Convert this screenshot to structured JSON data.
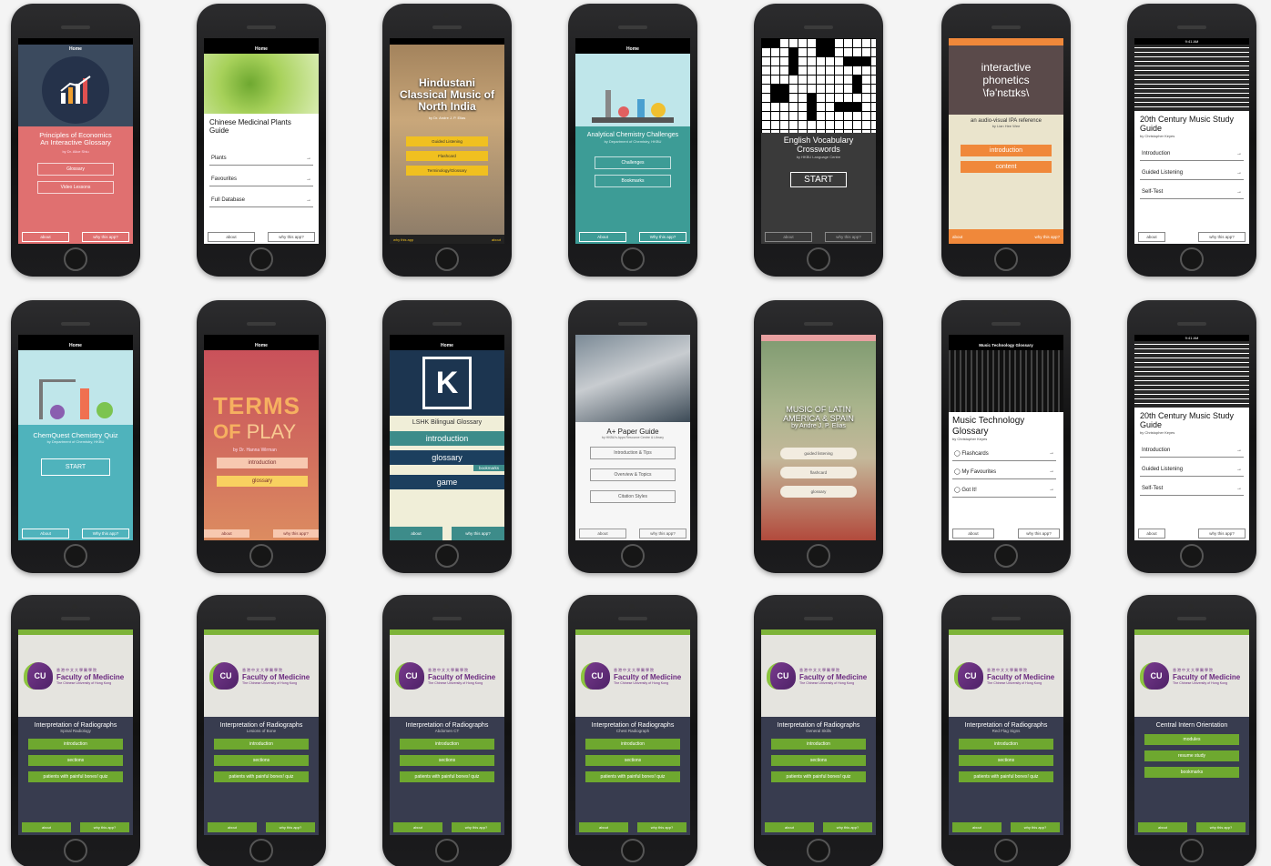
{
  "page": {
    "background": "#f4f4f4"
  },
  "phones": [
    {
      "id": "economics",
      "navbar": "Home",
      "title": "Principles of Economics",
      "subtitle": "An Interactive Glossary",
      "author": "by Dr. Alice Shiu",
      "buttons": [
        "Glossary",
        "Video Lessons"
      ],
      "footer": [
        "about",
        "why this app?"
      ],
      "icon": "bar-chart-icon",
      "color": "#e07070"
    },
    {
      "id": "plants",
      "navbar": "Home",
      "title": "Chinese Medicinal Plants Guide",
      "items": [
        "Plants",
        "Favourites",
        "Full Database"
      ],
      "footer": [
        "about",
        "why this app?"
      ],
      "color": "#8bbf3a"
    },
    {
      "id": "hindustani",
      "title": "Hindustani Classical Music of North India",
      "author": "by Dr. Andre J. P. Elias",
      "buttons": [
        "Guided Listening",
        "Flashcard",
        "Terminology/Glossary"
      ],
      "footer": [
        "why this app",
        "about"
      ],
      "color": "#f0c020"
    },
    {
      "id": "chemistry-challenges",
      "navbar": "Home",
      "title": "Analytical Chemistry Challenges",
      "author": "by Department of Chemistry, HKBU",
      "buttons": [
        "Challenges",
        "Bookmarks"
      ],
      "footer": [
        "About",
        "Why this app?"
      ],
      "color": "#3d9c96"
    },
    {
      "id": "crosswords",
      "title": "English Vocabulary Crosswords",
      "author": "by HKBU Language Centre",
      "button": "START",
      "footer": [
        "about",
        "why this app?"
      ],
      "color": "#3a3a3a"
    },
    {
      "id": "phonetics",
      "title": "interactive phonetics",
      "ipa": "\\fə'nɛtɪks\\",
      "subtitle": "an audio-visual IPA reference",
      "author": "by Lian Hee Wee",
      "buttons": [
        "introduction",
        "content"
      ],
      "footer": [
        "about",
        "why this app?"
      ],
      "color": "#f0883a"
    },
    {
      "id": "music20-a",
      "title": "20th Century Music Study Guide",
      "author": "by Christopher Keyes",
      "items": [
        "Introduction",
        "Guided Listening",
        "Self-Test"
      ],
      "footer": [
        "about",
        "why this app?"
      ],
      "status_time": "9:41 AM"
    },
    {
      "id": "chemquest",
      "navbar": "Home",
      "title": "ChemQuest Chemistry Quiz",
      "author": "by Department of Chemistry, HKBU",
      "button": "START",
      "footer": [
        "About",
        "Why this app?"
      ],
      "color": "#4fb3bc"
    },
    {
      "id": "terms",
      "navbar": "Home",
      "title_a": "TERMS",
      "title_b": "OF",
      "title_c": "PLAY",
      "author": "by Dr. Hanna Wirman",
      "buttons": [
        "introduction",
        "glossary"
      ],
      "footer": [
        "about",
        "why this app?"
      ],
      "color": "#cc5a5e"
    },
    {
      "id": "lshk",
      "navbar": "Home",
      "title": "LSHK Bilingual Glossary",
      "buttons": [
        "introduction",
        "glossary",
        "game"
      ],
      "badge": "bookmarks",
      "footer": [
        "about",
        "why this app?"
      ],
      "color": "#3d8c8a"
    },
    {
      "id": "paper",
      "title": "A+ Paper Guide",
      "author": "by HKBU's Apps Resource Centre & Library",
      "buttons": [
        "Introduction & Tips",
        "Overview & Topics",
        "Citation Styles"
      ],
      "footer": [
        "about",
        "why this app?"
      ]
    },
    {
      "id": "latin",
      "title": "MUSIC OF LATIN AMERICA & SPAIN",
      "author": "by Andre J. P. Elias",
      "buttons": [
        "guided listening",
        "flashcard",
        "glossary"
      ],
      "color": "#e8a0a0"
    },
    {
      "id": "musictech",
      "navbar": "Music Technology Glossary",
      "title": "Music Technology Glossary",
      "author": "by Christopher Keyes",
      "items": [
        "Flashcards",
        "My Favourites",
        "Got It!"
      ],
      "footer": [
        "about",
        "why this app?"
      ]
    },
    {
      "id": "music20-b",
      "title": "20th Century Music Study Guide",
      "author": "by Christopher Keyes",
      "items": [
        "Introduction",
        "Guided Listening",
        "Self-Test"
      ],
      "footer": [
        "about",
        "why this app?"
      ],
      "status_time": "9:41 AM"
    }
  ],
  "cu": {
    "chinese": "香港中文大學醫學院",
    "faculty": "Faculty of Medicine",
    "university": "The Chinese University of Hong Kong",
    "logo": "CU",
    "logo_sub": "Medicine",
    "apps": [
      {
        "title": "Interpretation of Radiographs",
        "sub": "Spinal Radiology",
        "buttons": [
          "introduction",
          "sections",
          "patients with painful bones! quiz"
        ]
      },
      {
        "title": "Interpretation of Radiographs",
        "sub": "Lesions of Bone",
        "buttons": [
          "introduction",
          "sections",
          "patients with painful bones! quiz"
        ]
      },
      {
        "title": "Interpretation of Radiographs",
        "sub": "Abdomen CT",
        "buttons": [
          "introduction",
          "sections",
          "patients with painful bones! quiz"
        ]
      },
      {
        "title": "Interpretation of Radiographs",
        "sub": "Chest Radiograph",
        "buttons": [
          "introduction",
          "sections",
          "patients with painful bones! quiz"
        ]
      },
      {
        "title": "Interpretation of Radiographs",
        "sub": "General Skills",
        "buttons": [
          "introduction",
          "sections",
          "patients with painful bones! quiz"
        ]
      },
      {
        "title": "Interpretation of Radiographs",
        "sub": "Red Flag Signs",
        "buttons": [
          "introduction",
          "sections",
          "patients with painful bones! quiz"
        ]
      },
      {
        "title": "Central Intern Orientation",
        "sub": "",
        "buttons": [
          "modules",
          "resume study",
          "bookmarks"
        ]
      }
    ],
    "footer": [
      "about",
      "why this app?"
    ]
  }
}
